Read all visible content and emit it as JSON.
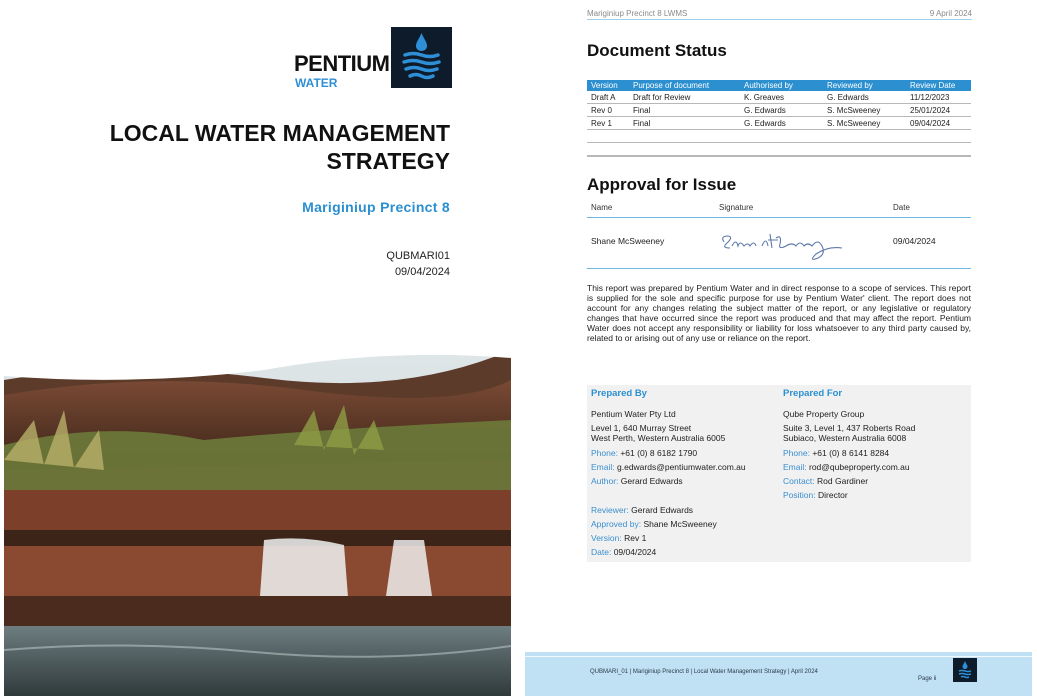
{
  "cover": {
    "logo_word": "PENTIUM",
    "logo_sub": "WATER",
    "title_line1": "LOCAL WATER MANAGEMENT",
    "title_line2": "STRATEGY",
    "subtitle": "Mariginiup Precinct 8",
    "code": "QUBMARI01",
    "date": "09/04/2024"
  },
  "header": {
    "left": "Mariginiup Precinct 8 LWMS",
    "right": "9 April 2024"
  },
  "document_status": {
    "title": "Document Status",
    "columns": [
      "Version",
      "Purpose of document",
      "Authorised by",
      "Reviewed by",
      "Review Date"
    ],
    "rows": [
      [
        "Draft A",
        "Draft for Review",
        "K. Greaves",
        "G. Edwards",
        "11/12/2023"
      ],
      [
        "Rev 0",
        "Final",
        "G. Edwards",
        "S. McSweeney",
        "25/01/2024"
      ],
      [
        "Rev 1",
        "Final",
        "G. Edwards",
        "S. McSweeney",
        "09/04/2024"
      ]
    ]
  },
  "approval": {
    "title": "Approval for Issue",
    "col_name": "Name",
    "col_signature": "Signature",
    "col_date": "Date",
    "name": "Shane McSweeney",
    "date": "09/04/2024"
  },
  "disclaimer": "This report was prepared by Pentium Water and in direct response to a scope of services. This report is supplied for the sole and specific purpose for use by Pentium Water' client. The report does not account for any changes relating the subject matter of the report, or any legislative or regulatory changes that have occurred since the report was produced and that may affect the report. Pentium Water does not accept any responsibility or liability for loss whatsoever to any third party caused by, related to or arising out of any use or reliance on the report.",
  "prepared_by": {
    "heading": "Prepared By",
    "company": "Pentium Water Pty Ltd",
    "address1": "Level 1, 640 Murray Street",
    "address2": "West Perth, Western Australia 6005",
    "phone_label": "Phone:",
    "phone": "+61 (0) 8 6182 1790",
    "email_label": "Email:",
    "email": "g.edwards@pentiumwater.com.au",
    "author_label": "Author:",
    "author": "Gerard Edwards",
    "reviewer_label": "Reviewer:",
    "reviewer": "Gerard Edwards",
    "approved_label": "Approved by:",
    "approved": "Shane McSweeney",
    "version_label": "Version:",
    "version": "Rev 1",
    "date_label": "Date:",
    "date": "09/04/2024"
  },
  "prepared_for": {
    "heading": "Prepared For",
    "company": "Qube Property Group",
    "address1": "Suite 3, Level 1, 437 Roberts Road",
    "address2": "Subiaco, Western Australia 6008",
    "phone_label": "Phone:",
    "phone": "+61 (0) 8 6141 8284",
    "email_label": "Email:",
    "email": "rod@qubeproperty.com.au",
    "contact_label": "Contact:",
    "contact": "Rod Gardiner",
    "position_label": "Position:",
    "position": "Director"
  },
  "footer": {
    "text": "QUBMARI_01 | Mariginiup Precinct 8 | Local Water Management Strategy | April 2024",
    "page": "Page ii"
  },
  "colors": {
    "accent_blue": "#2b8fd0",
    "logo_navy": "#0d1b2a",
    "footer_band": "#bfe1f3",
    "box_grey": "#f1f1f1"
  },
  "icons": {
    "logo": "water-drop-icon",
    "signature": "handwritten-signature"
  }
}
